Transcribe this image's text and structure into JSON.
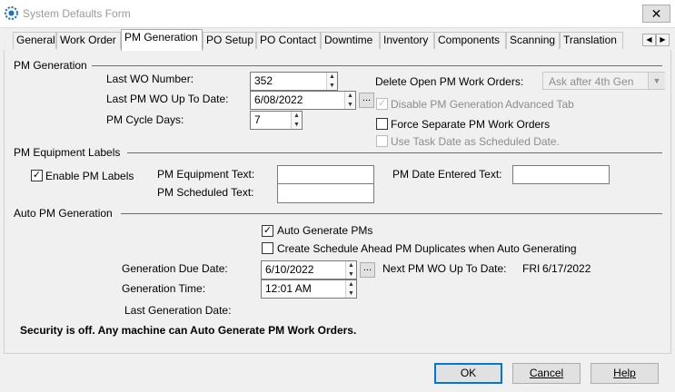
{
  "window": {
    "title": "System Defaults Form",
    "close_glyph": "✕"
  },
  "tabs": [
    {
      "label": "General"
    },
    {
      "label": "Work Order"
    },
    {
      "label": "PM Generation"
    },
    {
      "label": "PO Setup"
    },
    {
      "label": "PO Contact"
    },
    {
      "label": "Downtime"
    },
    {
      "label": "Inventory"
    },
    {
      "label": "Components"
    },
    {
      "label": "Scanning"
    },
    {
      "label": "Translation"
    }
  ],
  "active_tab": "PM Generation",
  "pm_generation": {
    "section_title": "PM Generation",
    "last_wo_number_label": "Last WO Number:",
    "last_wo_number_value": "352",
    "last_pm_wo_up_to_date_label": "Last PM WO Up To Date:",
    "last_pm_wo_up_to_date_value": "6/08/2022",
    "pm_cycle_days_label": "PM Cycle Days:",
    "pm_cycle_days_value": "7",
    "delete_open_pm_label": "Delete Open PM Work Orders:",
    "delete_open_pm_value": "Ask after 4th Gen",
    "disable_pm_generation_label": "Disable PM Generation",
    "disable_pm_generation_hint": "Advanced Tab",
    "disable_pm_generation_checked": true,
    "force_separate_label": "Force Separate PM Work Orders",
    "force_separate_checked": false,
    "use_task_date_label": "Use Task Date as Scheduled Date.",
    "use_task_date_checked": false
  },
  "pm_equipment_labels": {
    "section_title": "PM Equipment Labels",
    "enable_pm_labels_label": "Enable PM Labels",
    "enable_pm_labels_checked": true,
    "equipment_text_label": "PM Equipment Text:",
    "equipment_text_value": "",
    "scheduled_text_label": "PM Scheduled Text:",
    "scheduled_text_value": "",
    "date_entered_text_label": "PM Date Entered Text:",
    "date_entered_text_value": ""
  },
  "auto_pm_generation": {
    "section_title": "Auto PM Generation",
    "auto_generate_label": "Auto Generate PMs",
    "auto_generate_checked": true,
    "create_schedule_ahead_label": "Create Schedule Ahead PM Duplicates when Auto Generating",
    "create_schedule_ahead_checked": false,
    "generation_due_date_label": "Generation Due Date:",
    "generation_due_date_value": "6/10/2022",
    "next_pm_wo_label": "Next PM WO Up To Date:",
    "next_pm_wo_day": "FRI",
    "next_pm_wo_date": "6/17/2022",
    "generation_time_label": "Generation Time:",
    "generation_time_value": "12:01 AM",
    "last_generation_date_label": "Last Generation Date:",
    "last_generation_date_value": ""
  },
  "security_message": "Security is off. Any machine can Auto Generate PM Work Orders.",
  "buttons": {
    "ok": "OK",
    "cancel": "Cancel",
    "help": "Help"
  },
  "colors": {
    "accent": "#0078d7",
    "disabled_text": "#8d8d8d"
  }
}
